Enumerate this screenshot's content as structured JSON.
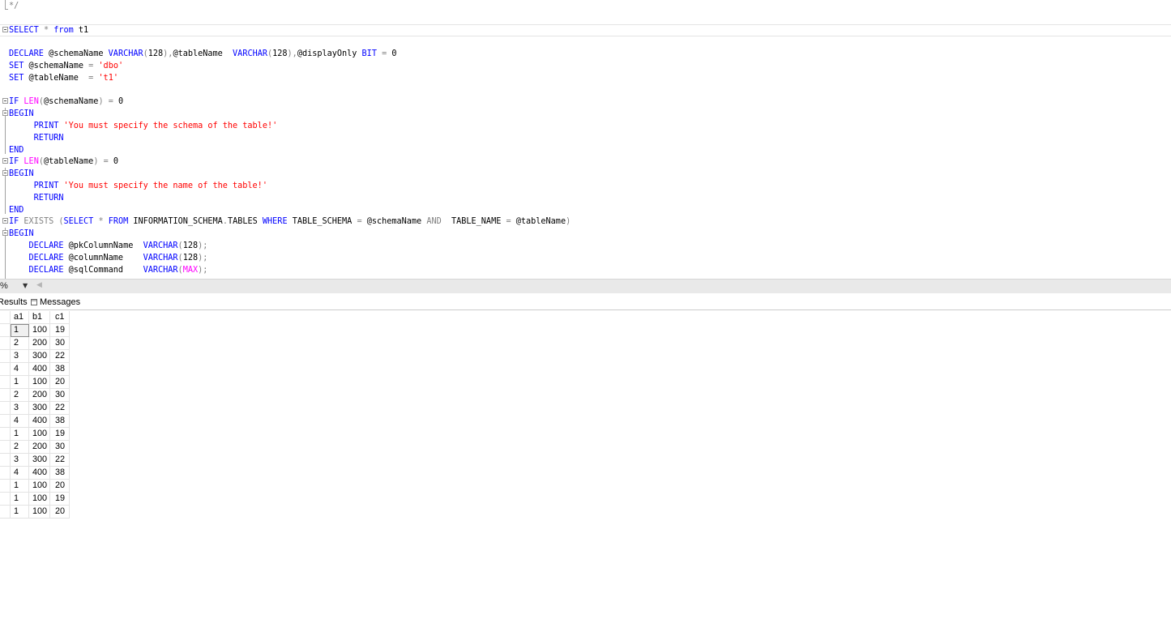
{
  "editor": {
    "lines": [
      {
        "fold": false,
        "segs": [
          {
            "t": "*/",
            "c": "gray"
          }
        ]
      },
      {
        "fold": false,
        "segs": []
      },
      {
        "fold": true,
        "segs": [
          {
            "t": "SELECT",
            "c": "kw"
          },
          {
            "t": " * ",
            "c": "op"
          },
          {
            "t": "from",
            "c": "kw"
          },
          {
            "t": " t1",
            "c": ""
          }
        ]
      },
      {
        "fold": false,
        "segs": []
      },
      {
        "fold": false,
        "segs": [
          {
            "t": "DECLARE",
            "c": "kw"
          },
          {
            "t": " @schemaName ",
            "c": ""
          },
          {
            "t": "VARCHAR",
            "c": "kw"
          },
          {
            "t": "(",
            "c": "op"
          },
          {
            "t": "128",
            "c": ""
          },
          {
            "t": "),",
            "c": "op"
          },
          {
            "t": "@tableName  ",
            "c": ""
          },
          {
            "t": "VARCHAR",
            "c": "kw"
          },
          {
            "t": "(",
            "c": "op"
          },
          {
            "t": "128",
            "c": ""
          },
          {
            "t": "),",
            "c": "op"
          },
          {
            "t": "@displayOnly ",
            "c": ""
          },
          {
            "t": "BIT",
            "c": "kw"
          },
          {
            "t": " = ",
            "c": "op"
          },
          {
            "t": "0",
            "c": ""
          }
        ]
      },
      {
        "fold": false,
        "segs": [
          {
            "t": "SET",
            "c": "kw"
          },
          {
            "t": " @schemaName ",
            "c": ""
          },
          {
            "t": "=",
            "c": "op"
          },
          {
            "t": " ",
            "c": ""
          },
          {
            "t": "'dbo'",
            "c": "str"
          }
        ]
      },
      {
        "fold": false,
        "segs": [
          {
            "t": "SET",
            "c": "kw"
          },
          {
            "t": " @tableName  ",
            "c": ""
          },
          {
            "t": "=",
            "c": "op"
          },
          {
            "t": " ",
            "c": ""
          },
          {
            "t": "'t1'",
            "c": "str"
          }
        ]
      },
      {
        "fold": false,
        "segs": []
      },
      {
        "fold": true,
        "segs": [
          {
            "t": "IF",
            "c": "kw"
          },
          {
            "t": " ",
            "c": ""
          },
          {
            "t": "LEN",
            "c": "fn"
          },
          {
            "t": "(",
            "c": "op"
          },
          {
            "t": "@schemaName",
            "c": ""
          },
          {
            "t": ")",
            "c": "op"
          },
          {
            "t": " = ",
            "c": "op"
          },
          {
            "t": "0",
            "c": ""
          }
        ]
      },
      {
        "fold": true,
        "segs": [
          {
            "t": "BEGIN",
            "c": "kw"
          }
        ]
      },
      {
        "fold": false,
        "segs": [
          {
            "t": "     PRINT",
            "c": "kw"
          },
          {
            "t": " ",
            "c": ""
          },
          {
            "t": "'You must specify the schema of the table!'",
            "c": "str"
          }
        ]
      },
      {
        "fold": false,
        "segs": [
          {
            "t": "     RETURN",
            "c": "kw"
          }
        ]
      },
      {
        "fold": false,
        "segs": [
          {
            "t": "END",
            "c": "kw"
          }
        ]
      },
      {
        "fold": true,
        "segs": [
          {
            "t": "IF",
            "c": "kw"
          },
          {
            "t": " ",
            "c": ""
          },
          {
            "t": "LEN",
            "c": "fn"
          },
          {
            "t": "(",
            "c": "op"
          },
          {
            "t": "@tableName",
            "c": ""
          },
          {
            "t": ")",
            "c": "op"
          },
          {
            "t": " = ",
            "c": "op"
          },
          {
            "t": "0",
            "c": ""
          }
        ]
      },
      {
        "fold": true,
        "segs": [
          {
            "t": "BEGIN",
            "c": "kw"
          }
        ]
      },
      {
        "fold": false,
        "segs": [
          {
            "t": "     PRINT",
            "c": "kw"
          },
          {
            "t": " ",
            "c": ""
          },
          {
            "t": "'You must specify the name of the table!'",
            "c": "str"
          }
        ]
      },
      {
        "fold": false,
        "segs": [
          {
            "t": "     RETURN",
            "c": "kw"
          }
        ]
      },
      {
        "fold": false,
        "segs": [
          {
            "t": "END",
            "c": "kw"
          }
        ]
      },
      {
        "fold": true,
        "segs": [
          {
            "t": "IF",
            "c": "kw"
          },
          {
            "t": " ",
            "c": ""
          },
          {
            "t": "EXISTS",
            "c": "gray"
          },
          {
            "t": " (",
            "c": "op"
          },
          {
            "t": "SELECT",
            "c": "kw"
          },
          {
            "t": " * ",
            "c": "op"
          },
          {
            "t": "FROM",
            "c": "kw"
          },
          {
            "t": " INFORMATION_SCHEMA",
            "c": ""
          },
          {
            "t": ".",
            "c": "op"
          },
          {
            "t": "TABLES ",
            "c": ""
          },
          {
            "t": "WHERE",
            "c": "kw"
          },
          {
            "t": " TABLE_SCHEMA ",
            "c": ""
          },
          {
            "t": "=",
            "c": "op"
          },
          {
            "t": " @schemaName ",
            "c": ""
          },
          {
            "t": "AND",
            "c": "gray"
          },
          {
            "t": "  TABLE_NAME ",
            "c": ""
          },
          {
            "t": "=",
            "c": "op"
          },
          {
            "t": " @tableName",
            "c": ""
          },
          {
            "t": ")",
            "c": "op"
          }
        ]
      },
      {
        "fold": true,
        "segs": [
          {
            "t": "BEGIN",
            "c": "kw"
          }
        ]
      },
      {
        "fold": false,
        "segs": [
          {
            "t": "    DECLARE",
            "c": "kw"
          },
          {
            "t": " @pkColumnName  ",
            "c": ""
          },
          {
            "t": "VARCHAR",
            "c": "kw"
          },
          {
            "t": "(",
            "c": "op"
          },
          {
            "t": "128",
            "c": ""
          },
          {
            "t": ");",
            "c": "op"
          }
        ]
      },
      {
        "fold": false,
        "segs": [
          {
            "t": "    DECLARE",
            "c": "kw"
          },
          {
            "t": " @columnName    ",
            "c": ""
          },
          {
            "t": "VARCHAR",
            "c": "kw"
          },
          {
            "t": "(",
            "c": "op"
          },
          {
            "t": "128",
            "c": ""
          },
          {
            "t": ");",
            "c": "op"
          }
        ]
      },
      {
        "fold": false,
        "segs": [
          {
            "t": "    DECLARE",
            "c": "kw"
          },
          {
            "t": " @sqlCommand    ",
            "c": ""
          },
          {
            "t": "VARCHAR",
            "c": "kw"
          },
          {
            "t": "(",
            "c": "op"
          },
          {
            "t": "MAX",
            "c": "fn"
          },
          {
            "t": ");",
            "c": "op"
          }
        ]
      }
    ]
  },
  "status": {
    "zoom": "%",
    "zoom_arrow": "▼",
    "scroll_left": "◀"
  },
  "tabs": {
    "results_label": "Results",
    "messages_label": "Messages"
  },
  "grid": {
    "columns": [
      "a1",
      "b1",
      "c1"
    ],
    "rows": [
      [
        "1",
        "100",
        "19"
      ],
      [
        "2",
        "200",
        "30"
      ],
      [
        "3",
        "300",
        "22"
      ],
      [
        "4",
        "400",
        "38"
      ],
      [
        "1",
        "100",
        "20"
      ],
      [
        "2",
        "200",
        "30"
      ],
      [
        "3",
        "300",
        "22"
      ],
      [
        "4",
        "400",
        "38"
      ],
      [
        "1",
        "100",
        "19"
      ],
      [
        "2",
        "200",
        "30"
      ],
      [
        "3",
        "300",
        "22"
      ],
      [
        "4",
        "400",
        "38"
      ],
      [
        "1",
        "100",
        "20"
      ],
      [
        "1",
        "100",
        "19"
      ],
      [
        "1",
        "100",
        "20"
      ]
    ]
  }
}
